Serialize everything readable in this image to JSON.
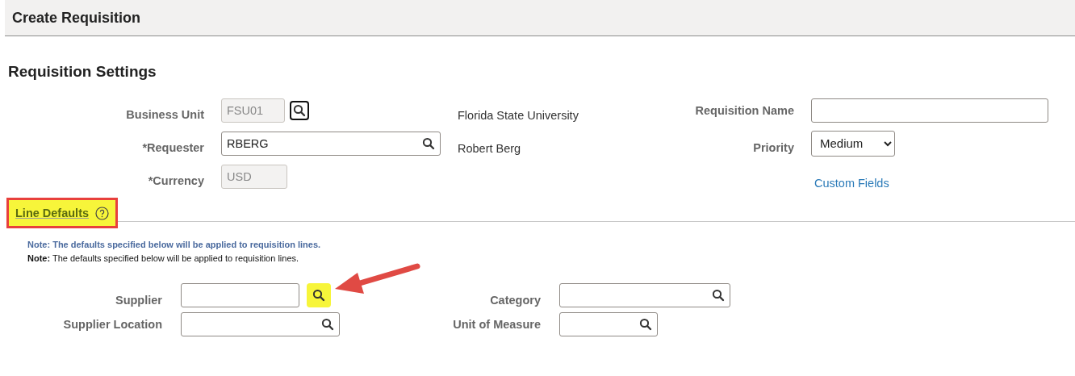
{
  "header": {
    "title": "Create Requisition"
  },
  "settings": {
    "title": "Requisition Settings",
    "fields": [
      {
        "label": "Business Unit",
        "kind": "readonly-lookup",
        "value": "FSU01",
        "description": "Florida State University"
      },
      {
        "label": "*Requester",
        "kind": "lookup",
        "value": "RBERG",
        "description": "Robert Berg"
      },
      {
        "label": "*Currency",
        "kind": "readonly",
        "value": "USD"
      }
    ],
    "right_fields": [
      {
        "label": "Requisition Name",
        "kind": "text"
      },
      {
        "label": "Priority",
        "kind": "select",
        "value": "Medium"
      }
    ],
    "link": "Custom Fields"
  },
  "line_defaults": {
    "title": "Line Defaults",
    "highlighted": true,
    "notes": [
      {
        "kind": "info",
        "text": "**Note:** The defaults specified below will be applied to requisition lines."
      },
      {
        "kind": "plain",
        "text": "**Note:** The defaults specified below will be applied to requisition lines."
      }
    ],
    "fields": [
      {
        "label": "Supplier",
        "kind": "external-lookup",
        "highlighted": true
      },
      {
        "label": "Category",
        "kind": "lookup",
        "highlighted": false
      },
      {
        "label": "Supplier Location",
        "kind": "lookup",
        "highlighted": false
      },
      {
        "label": "Unit of Measure",
        "kind": "lookup",
        "highlighted": false
      }
    ]
  }
}
